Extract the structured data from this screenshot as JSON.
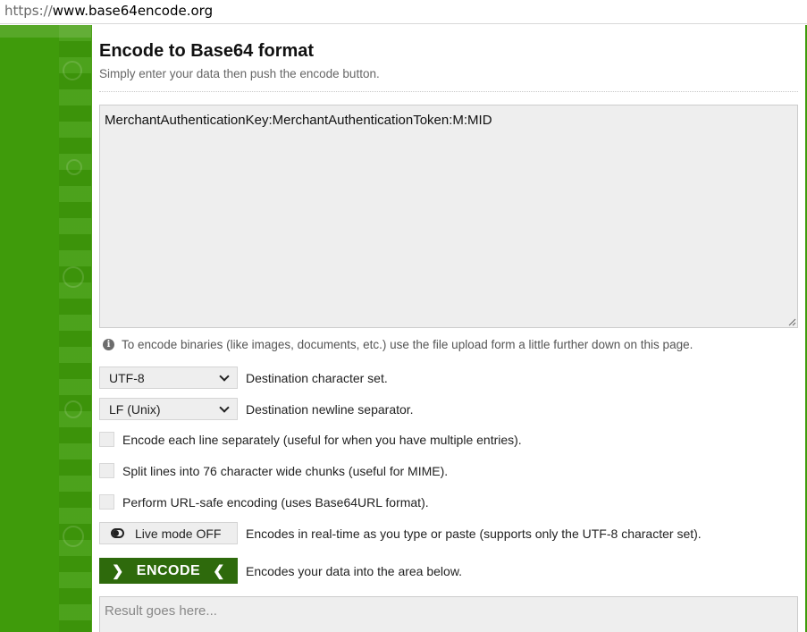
{
  "browser": {
    "url_protocol": "https://",
    "url_host": "www.base64encode.org"
  },
  "page": {
    "title": "Encode to Base64 format",
    "subtitle": "Simply enter your data then push the encode button."
  },
  "input": {
    "value": "MerchantAuthenticationKey:MerchantAuthenticationToken:M:MID"
  },
  "info": {
    "icon": "info-icon",
    "text": "To encode binaries (like images, documents, etc.) use the file upload form a little further down on this page."
  },
  "options": {
    "charset": {
      "selected": "UTF-8",
      "description": "Destination character set."
    },
    "newline": {
      "selected": "LF (Unix)",
      "description": "Destination newline separator."
    },
    "checkboxes": [
      {
        "label": "Encode each line separately (useful for when you have multiple entries).",
        "checked": false
      },
      {
        "label": "Split lines into 76 character wide chunks (useful for MIME).",
        "checked": false
      },
      {
        "label": "Perform URL-safe encoding (uses Base64URL format).",
        "checked": false
      }
    ],
    "live_mode": {
      "label": "Live mode OFF",
      "description": "Encodes in real-time as you type or paste (supports only the UTF-8 character set)."
    }
  },
  "encode": {
    "label": "ENCODE",
    "description": "Encodes your data into the area below."
  },
  "result": {
    "placeholder": "Result goes here..."
  },
  "colors": {
    "brand_green": "#3f9b0b",
    "button_green": "#2e6a0c",
    "field_bg": "#eeeeee"
  }
}
